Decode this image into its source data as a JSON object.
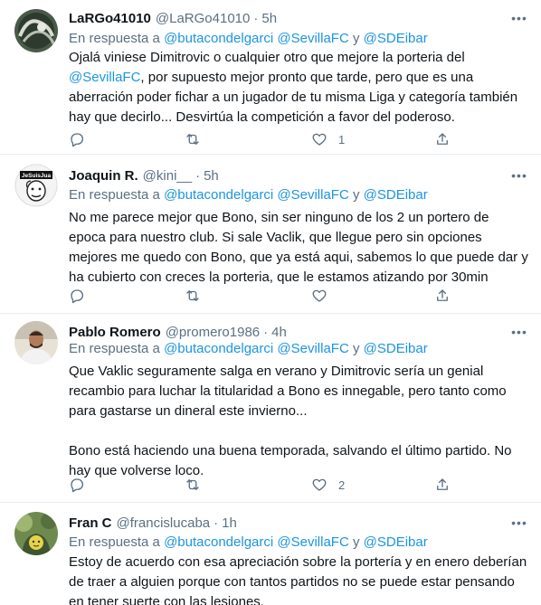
{
  "colors": {
    "link": "#1b95e0",
    "muted": "#5b7083",
    "text": "#0f1419",
    "divider": "#e6ecf0"
  },
  "icons": {
    "reply": "reply-icon",
    "retweet": "retweet-icon",
    "like": "heart-icon",
    "share": "share-icon",
    "more": "more-icon"
  },
  "reply_prefix": "En respuesta a",
  "and_word": "y",
  "more_glyph": "•••",
  "tweets": [
    {
      "name": "LaRGo41010",
      "handle": "@LaRGo41010",
      "separator": "·",
      "time": "5h",
      "reply_to": [
        "@butacondelgarci",
        "@SevillaFC",
        "@SDEibar"
      ],
      "text_before": "Ojalá viniese Dimitrovic o cualquier otro que mejore la porteria del ",
      "text_mention": "@SevillaFC",
      "text_after": ", por supuesto mejor pronto que tarde, pero que es una aberración poder fichar a un jugador de tu misma Liga y categoría también hay que decirlo... Desvirtúa la competición a favor del poderoso.",
      "counts": {
        "reply": "",
        "retweet": "",
        "like": "1"
      }
    },
    {
      "name": "Joaquin R.",
      "handle": "@kini__",
      "separator": "·",
      "time": "5h",
      "avatar_text": "JeSuisJua",
      "reply_to": [
        "@butacondelgarci",
        "@SevillaFC",
        "@SDEibar"
      ],
      "text": "No me parece mejor que Bono, sin ser ninguno de los 2 un portero de epoca para nuestro club. Si sale Vaclik, que llegue pero sin opciones mejores me quedo con Bono, que ya está aqui, sabemos lo que puede dar y ha cubierto con creces la porteria, que le estamos atizando por 30min",
      "counts": {
        "reply": "",
        "retweet": "",
        "like": ""
      }
    },
    {
      "name": "Pablo Romero",
      "handle": "@promero1986",
      "separator": "·",
      "time": "4h",
      "reply_to": [
        "@butacondelgarci",
        "@SevillaFC",
        "@SDEibar"
      ],
      "text": "Que Vaklic seguramente salga en verano y Dimitrovic sería un genial recambio para luchar la titularidad a Bono es innegable, pero tanto como para gastarse un dineral este invierno...\n\nBono está haciendo una buena temporada, salvando el último partido. No hay que volverse loco.",
      "counts": {
        "reply": "",
        "retweet": "",
        "like": "2"
      }
    },
    {
      "name": "Fran C",
      "handle": "@francislucaba",
      "separator": "·",
      "time": "1h",
      "reply_to": [
        "@butacondelgarci",
        "@SevillaFC",
        "@SDEibar"
      ],
      "text": "Estoy de acuerdo con esa apreciación sobre la portería y en enero deberían de traer a alguien porque con tantos partidos no se puede estar pensando en tener suerte con las lesiones.",
      "counts": {
        "reply": "",
        "retweet": "",
        "like": ""
      }
    }
  ]
}
